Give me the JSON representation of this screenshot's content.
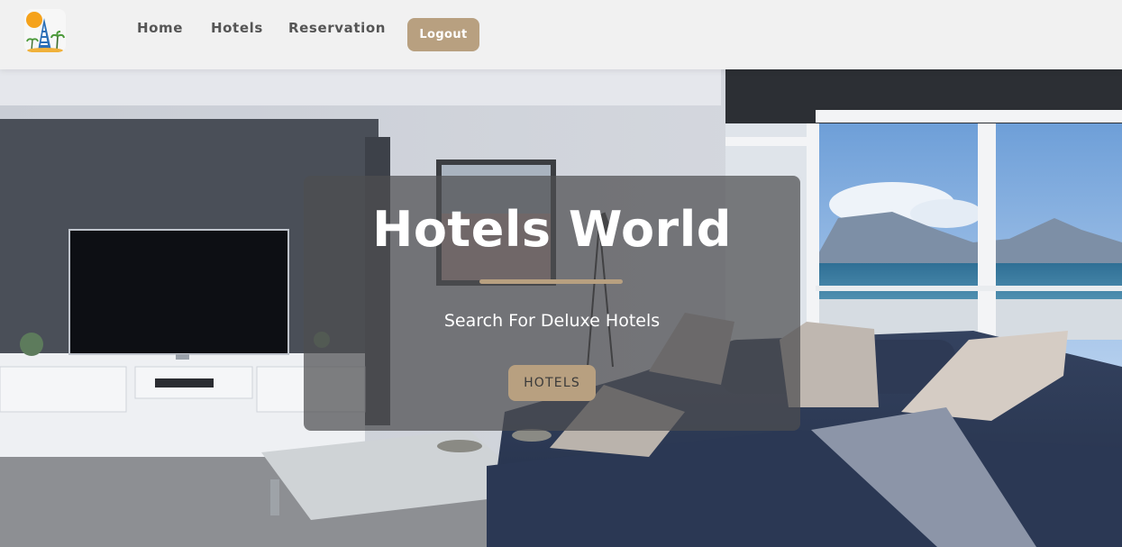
{
  "nav": {
    "logo_icon": "hotel-building-sun-palm-logo",
    "links": [
      {
        "label": "Home"
      },
      {
        "label": "Hotels"
      },
      {
        "label": "Reservation"
      }
    ],
    "logout_label": "Logout"
  },
  "hero": {
    "background": "living-room-with-sea-view-photo",
    "title": "Hotels World",
    "subtitle": "Search For Deluxe Hotels",
    "button_label": "HOTELS"
  },
  "colors": {
    "accent": "#b8a080",
    "navbar_bg": "#f1f1f1",
    "nav_text": "#555555",
    "card_overlay": "rgba(78,78,80,0.72)"
  }
}
